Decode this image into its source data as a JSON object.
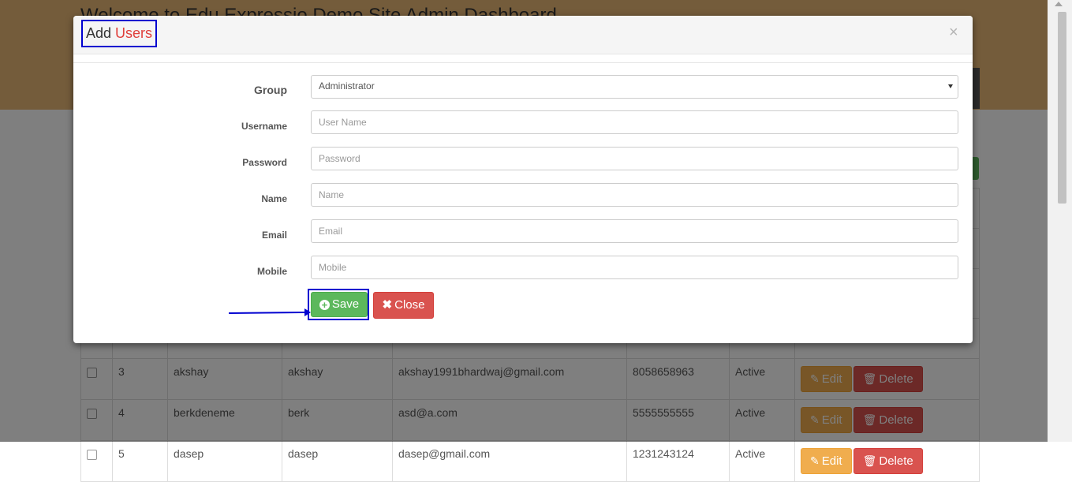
{
  "page": {
    "title": "Welcome to Edu Expressio Demo Site Admin Dashboard"
  },
  "table": {
    "rows": [
      {
        "no": "3",
        "name": "akshay",
        "username": "akshay",
        "email": "akshay1991bhardwaj@gmail.com",
        "mobile": "8058658963",
        "status": "Active"
      },
      {
        "no": "4",
        "name": "berkdeneme",
        "username": "berk",
        "email": "asd@a.com",
        "mobile": "5555555555",
        "status": "Active"
      },
      {
        "no": "5",
        "name": "dasep",
        "username": "dasep",
        "email": "dasep@gmail.com",
        "mobile": "1231243124",
        "status": "Active"
      }
    ],
    "edit_label": "Edit",
    "delete_label": "Delete"
  },
  "modal": {
    "title_prefix": "Add",
    "title_accent": "Users",
    "close_glyph": "×",
    "fields": {
      "group": {
        "label": "Group",
        "value": "Administrator"
      },
      "username": {
        "label": "Username",
        "placeholder": "User Name"
      },
      "password": {
        "label": "Password",
        "placeholder": "Password"
      },
      "name": {
        "label": "Name",
        "placeholder": "Name"
      },
      "email": {
        "label": "Email",
        "placeholder": "Email"
      },
      "mobile": {
        "label": "Mobile",
        "placeholder": "Mobile"
      }
    },
    "save_label": "Save",
    "close_label": "Close"
  },
  "colors": {
    "header": "#e9b877",
    "save": "#5cb85c",
    "close": "#d9534f",
    "edit": "#f0ad4e",
    "annotation": "#0000d0",
    "title_accent": "#e0403c"
  },
  "icons": {
    "save": "plus-circle-icon",
    "close": "times-icon",
    "edit": "edit-icon",
    "delete": "trash-icon"
  }
}
